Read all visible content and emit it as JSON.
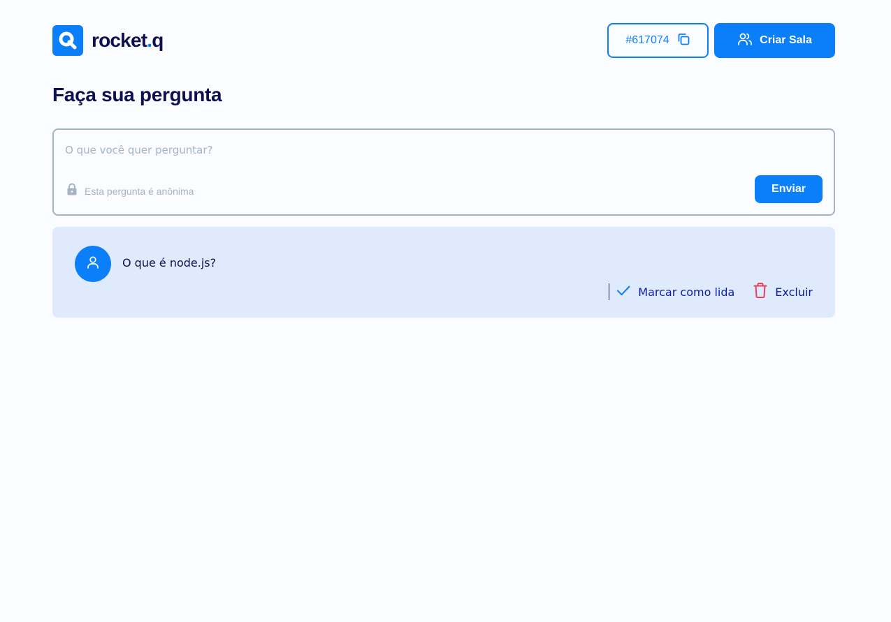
{
  "header": {
    "logo": {
      "word": "rocket",
      "dot": ".",
      "suffix": "q",
      "icon": "rocketq-logo-icon"
    },
    "room_code": {
      "label": "#617074",
      "icon": "copy-icon"
    },
    "create_room": {
      "label": "Criar Sala",
      "icon": "users-icon"
    }
  },
  "page": {
    "title": "Faça sua pergunta"
  },
  "form": {
    "placeholder": "O que você quer perguntar?",
    "value": "",
    "anonymous_label": "Esta pergunta é anônima",
    "anonymous_icon": "lock-icon",
    "send_label": "Enviar"
  },
  "questions": [
    {
      "text": "O que é node.js?",
      "avatar_icon": "user-icon",
      "actions": {
        "mark_read": {
          "label": "Marcar como lida",
          "icon": "check-icon"
        },
        "delete": {
          "label": "Excluir",
          "icon": "trash-icon"
        }
      }
    }
  ],
  "colors": {
    "accent": "#0a7ff9",
    "title": "#0d114f",
    "muted": "#a5b3c8",
    "card_bg": "#dfebfd",
    "danger": "#e73f5d",
    "page_bg": "#fbfcff"
  }
}
